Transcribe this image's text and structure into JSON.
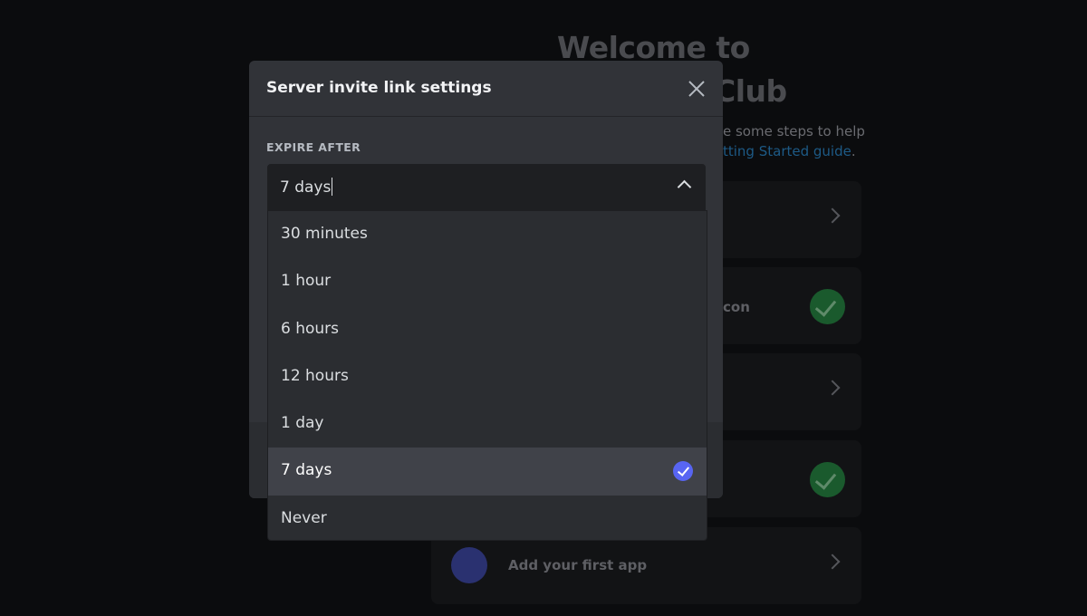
{
  "background": {
    "title_line1": "Welcome to",
    "title_line2_fragment": "Club",
    "subtitle_fragment": "e some steps to help",
    "guide_link_fragment": "tting Started guide",
    "guide_link_suffix": ".",
    "cards": [
      {
        "text": "",
        "status": "chevron"
      },
      {
        "text": "con",
        "status": "done"
      },
      {
        "text": "",
        "status": "chevron"
      },
      {
        "text": "",
        "status": "done"
      },
      {
        "text": "Add your first app",
        "status": "chevron",
        "icon": "app-icon"
      }
    ]
  },
  "modal": {
    "title": "Server invite link settings",
    "close_icon": "close-icon",
    "expire_label": "EXPIRE AFTER",
    "expire_value": "7 days",
    "options": [
      {
        "label": "30 minutes",
        "selected": false
      },
      {
        "label": "1 hour",
        "selected": false
      },
      {
        "label": "6 hours",
        "selected": false
      },
      {
        "label": "12 hours",
        "selected": false
      },
      {
        "label": "1 day",
        "selected": false
      },
      {
        "label": "7 days",
        "selected": true
      },
      {
        "label": "Never",
        "selected": false
      }
    ]
  },
  "colors": {
    "accent": "#5865f2",
    "success": "#23a55a",
    "link": "#00a8fc"
  }
}
